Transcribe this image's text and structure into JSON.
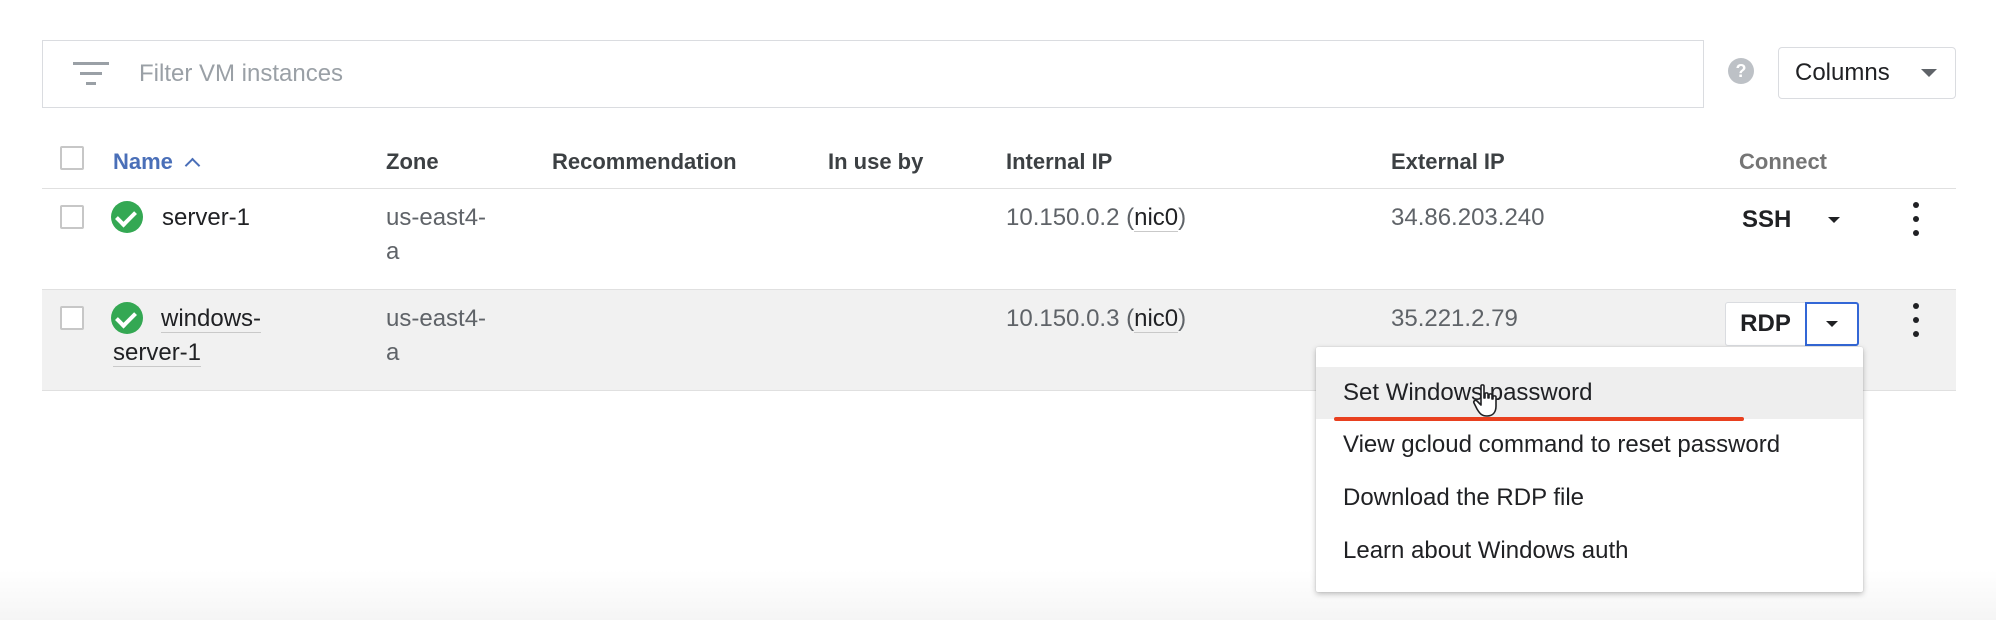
{
  "filter": {
    "placeholder": "Filter VM instances",
    "icon": "filter-icon"
  },
  "toolbar": {
    "help_icon": "help-icon",
    "help_glyph": "?",
    "columns_label": "Columns"
  },
  "table": {
    "headers": {
      "name": "Name",
      "zone": "Zone",
      "recommendation": "Recommendation",
      "in_use_by": "In use by",
      "internal_ip": "Internal IP",
      "external_ip": "External IP",
      "connect": "Connect"
    },
    "sort": {
      "column": "Name",
      "direction": "ascending"
    },
    "rows": [
      {
        "status": "running",
        "name": "server-1",
        "zone_line1": "us-east4-",
        "zone_line2": "a",
        "recommendation": "",
        "in_use_by": "",
        "internal_ip": "10.150.0.2 (",
        "nic": "nic0",
        "internal_ip_close": ")",
        "external_ip": "34.86.203.240",
        "connect": "SSH"
      },
      {
        "status": "running",
        "name_line1": "windows-",
        "name_line2": "server-1",
        "zone_line1": "us-east4-",
        "zone_line2": "a",
        "recommendation": "",
        "in_use_by": "",
        "internal_ip": "10.150.0.3 (",
        "nic": "nic0",
        "internal_ip_close": ")",
        "external_ip": "35.221.2.79",
        "connect": "RDP"
      }
    ]
  },
  "menu": {
    "items": [
      "Set Windows password",
      "View gcloud command to reset password",
      "Download the RDP file",
      "Learn about Windows auth"
    ],
    "hovered_index": 0
  },
  "colors": {
    "accent": "#4a6fb8",
    "status_ok": "#34a853",
    "highlight_line": "#e8401f",
    "focus_border": "#3367d6"
  }
}
